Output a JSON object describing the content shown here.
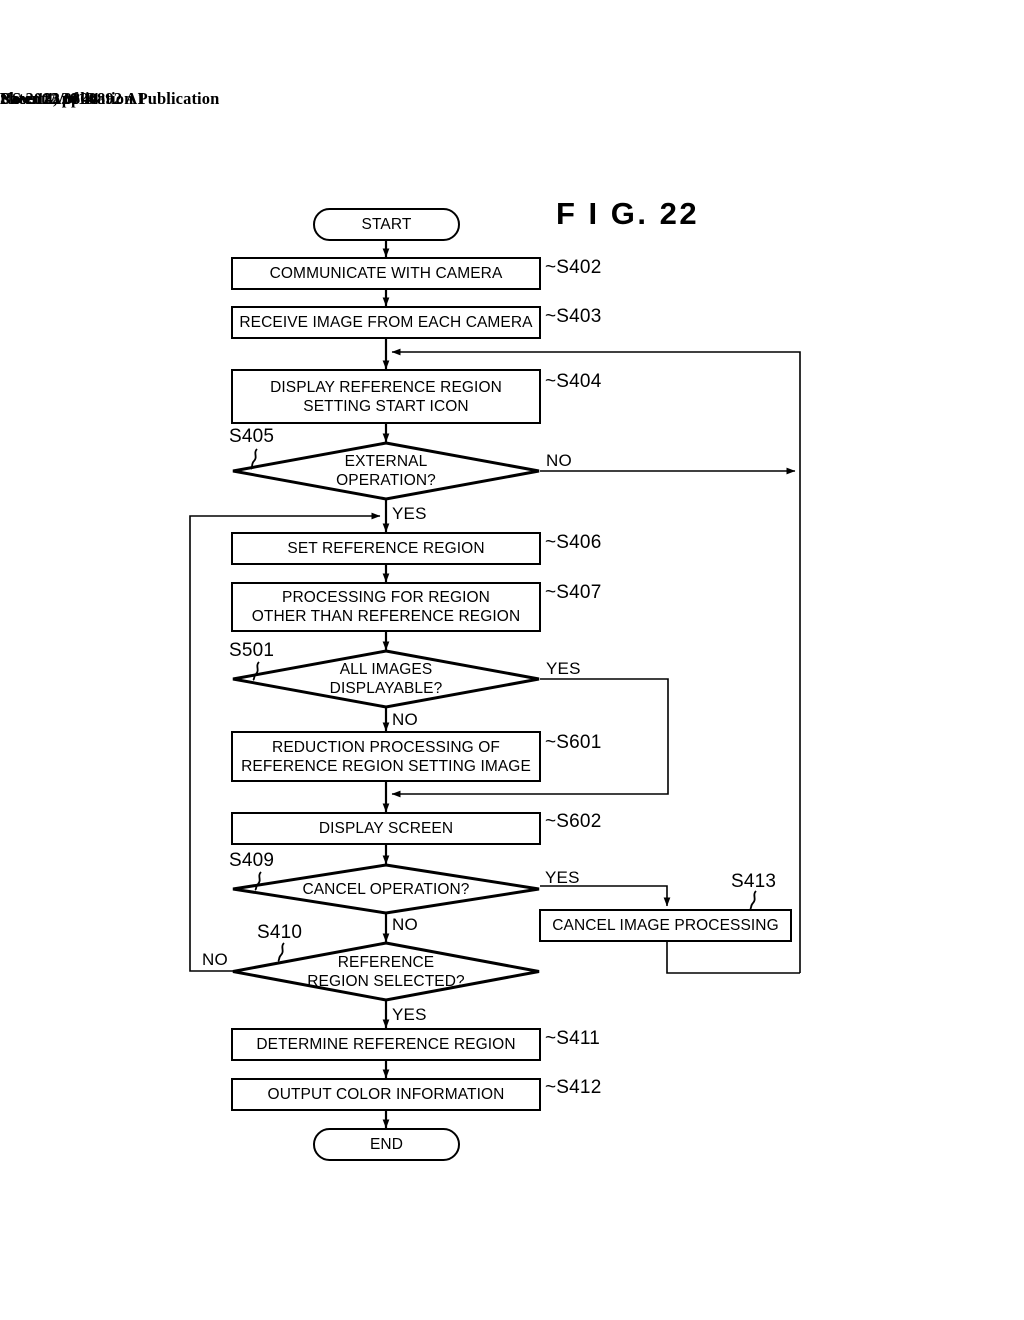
{
  "header": {
    "publication": "Patent Application Publication",
    "date": "Nov. 14, 2013",
    "sheet": "Sheet 22 of 44",
    "number": "US 2013/0300892 A1"
  },
  "figure": {
    "title": "F I G.  22"
  },
  "chart_data": {
    "type": "diagram",
    "diagram_kind": "flowchart",
    "title": "F I G.  22",
    "nodes": [
      {
        "id": "start",
        "shape": "terminal",
        "label": "START",
        "step": null
      },
      {
        "id": "s402",
        "shape": "process",
        "label": "COMMUNICATE WITH CAMERA",
        "step": "S402"
      },
      {
        "id": "s403",
        "shape": "process",
        "label": "RECEIVE IMAGE FROM EACH CAMERA",
        "step": "S403"
      },
      {
        "id": "s404",
        "shape": "process",
        "label": "DISPLAY REFERENCE REGION\nSETTING START ICON",
        "step": "S404"
      },
      {
        "id": "s405",
        "shape": "decision",
        "label": "EXTERNAL\nOPERATION?",
        "step": "S405"
      },
      {
        "id": "s406",
        "shape": "process",
        "label": "SET REFERENCE REGION",
        "step": "S406"
      },
      {
        "id": "s407",
        "shape": "process",
        "label": "PROCESSING FOR REGION\nOTHER THAN REFERENCE REGION",
        "step": "S407"
      },
      {
        "id": "s501",
        "shape": "decision",
        "label": "ALL IMAGES\nDISPLAYABLE?",
        "step": "S501"
      },
      {
        "id": "s601",
        "shape": "process",
        "label": "REDUCTION PROCESSING OF\nREFERENCE REGION SETTING IMAGE",
        "step": "S601"
      },
      {
        "id": "s602",
        "shape": "process",
        "label": "DISPLAY SCREEN",
        "step": "S602"
      },
      {
        "id": "s409",
        "shape": "decision",
        "label": "CANCEL OPERATION?",
        "step": "S409"
      },
      {
        "id": "s413",
        "shape": "process",
        "label": "CANCEL IMAGE PROCESSING",
        "step": "S413"
      },
      {
        "id": "s410",
        "shape": "decision",
        "label": "REFERENCE\nREGION SELECTED?",
        "step": "S410"
      },
      {
        "id": "s411",
        "shape": "process",
        "label": "DETERMINE REFERENCE REGION",
        "step": "S411"
      },
      {
        "id": "s412",
        "shape": "process",
        "label": "OUTPUT COLOR INFORMATION",
        "step": "S412"
      },
      {
        "id": "end",
        "shape": "terminal",
        "label": "END",
        "step": null
      }
    ],
    "edges": [
      {
        "from": "start",
        "to": "s402",
        "label": ""
      },
      {
        "from": "s402",
        "to": "s403",
        "label": ""
      },
      {
        "from": "s403",
        "to": "s404",
        "label": ""
      },
      {
        "from": "s404",
        "to": "s405",
        "label": ""
      },
      {
        "from": "s405",
        "to": "s406",
        "label": "YES"
      },
      {
        "from": "s405",
        "to": "right-return-bus",
        "label": "NO"
      },
      {
        "from": "s406",
        "to": "s407",
        "label": ""
      },
      {
        "from": "s407",
        "to": "s501",
        "label": ""
      },
      {
        "from": "s501",
        "to": "s601",
        "label": "NO"
      },
      {
        "from": "s501",
        "to": "s602",
        "label": "YES"
      },
      {
        "from": "s601",
        "to": "s602",
        "label": ""
      },
      {
        "from": "s602",
        "to": "s409",
        "label": ""
      },
      {
        "from": "s409",
        "to": "s413",
        "label": "YES"
      },
      {
        "from": "s409",
        "to": "s410",
        "label": "NO"
      },
      {
        "from": "s410",
        "to": "s406",
        "label": "NO"
      },
      {
        "from": "s410",
        "to": "s411",
        "label": "YES"
      },
      {
        "from": "s413",
        "to": "right-return-bus",
        "label": ""
      },
      {
        "from": "right-return-bus",
        "to": "s404",
        "label": ""
      },
      {
        "from": "s411",
        "to": "s412",
        "label": ""
      },
      {
        "from": "s412",
        "to": "end",
        "label": ""
      }
    ],
    "branch_labels": {
      "s405_no": "NO",
      "s405_yes": "YES",
      "s501_yes": "YES",
      "s501_no": "NO",
      "s409_yes": "YES",
      "s409_no": "NO",
      "s410_no": "NO",
      "s410_yes": "YES"
    },
    "step_prefix": "~"
  }
}
